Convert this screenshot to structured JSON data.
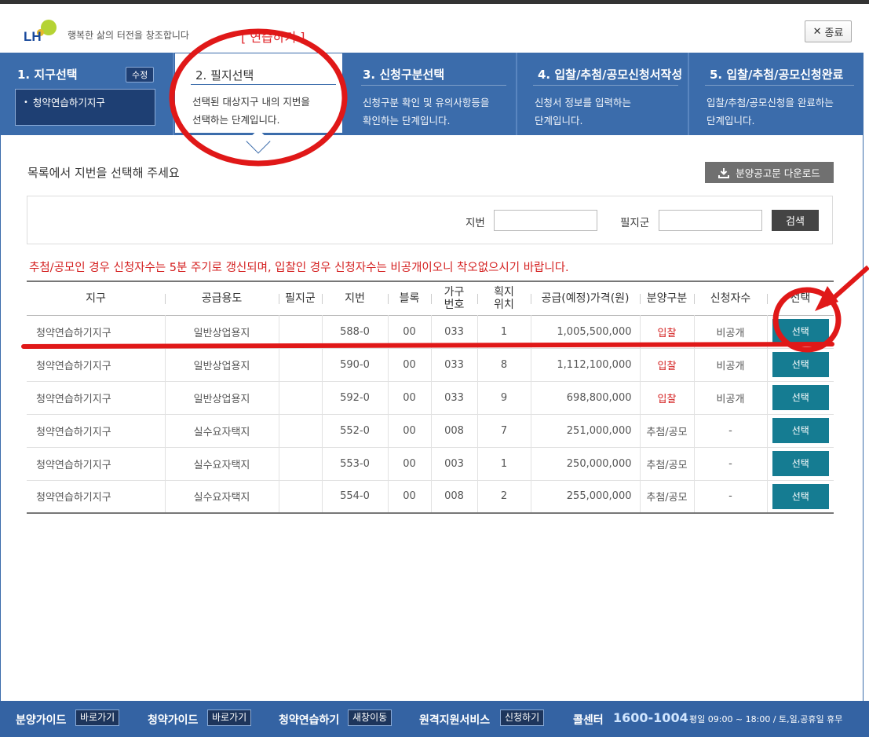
{
  "header": {
    "logo_text": "LH",
    "slogan": "행복한 삶의 터전을 창조합니다",
    "practice_label": "[ 연습하기 ]",
    "close_label": "종료"
  },
  "steps": [
    {
      "title": "1. 지구선택",
      "edit_label": "수정",
      "selected_district": "청약연습하기지구"
    },
    {
      "title": "2. 필지선택",
      "desc_line1": "선택된 대상지구 내의 지번을",
      "desc_line2": "선택하는 단계입니다."
    },
    {
      "title": "3. 신청구분선택",
      "desc_line1": "신청구분 확인 및 유의사항등을",
      "desc_line2": "확인하는 단계입니다."
    },
    {
      "title": "4. 입찰/추첨/공모신청서작성",
      "desc_line1": "신청서 정보를 입력하는",
      "desc_line2": "단계입니다."
    },
    {
      "title": "5. 입찰/추첨/공모신청완료",
      "desc_line1": "입찰/추첨/공모신청을 완료하는",
      "desc_line2": "단계입니다."
    }
  ],
  "main": {
    "instruction": "목록에서 지번을 선택해 주세요",
    "download_label": "분양공고문 다운로드",
    "search": {
      "lot_label": "지번",
      "lot_value": "",
      "group_label": "필지군",
      "group_value": "",
      "button_label": "검색"
    },
    "notice": "추첨/공모인 경우 신청자수는 5분 주기로 갱신되며, 입찰인 경우 신청자수는 비공개이오니 착오없으시기 바랍니다."
  },
  "table": {
    "headers": [
      "지구",
      "공급용도",
      "필지군",
      "지번",
      "블록",
      "가구번호",
      "획지위치",
      "공급(예정)가격(원)",
      "분양구분",
      "신청자수",
      "선택"
    ],
    "header_wrapped": {
      "h5a": "가구",
      "h5b": "번호",
      "h6a": "획지",
      "h6b": "위치"
    },
    "rows": [
      {
        "district": "청약연습하기지구",
        "use": "일반상업용지",
        "group": "",
        "lot": "588-0",
        "block": "00",
        "unit": "033",
        "position": "1",
        "price": "1,005,500,000",
        "type": "입찰",
        "applicants": "비공개",
        "select": "선택"
      },
      {
        "district": "청약연습하기지구",
        "use": "일반상업용지",
        "group": "",
        "lot": "590-0",
        "block": "00",
        "unit": "033",
        "position": "8",
        "price": "1,112,100,000",
        "type": "입찰",
        "applicants": "비공개",
        "select": "선택"
      },
      {
        "district": "청약연습하기지구",
        "use": "일반상업용지",
        "group": "",
        "lot": "592-0",
        "block": "00",
        "unit": "033",
        "position": "9",
        "price": "698,800,000",
        "type": "입찰",
        "applicants": "비공개",
        "select": "선택"
      },
      {
        "district": "청약연습하기지구",
        "use": "실수요자택지",
        "group": "",
        "lot": "552-0",
        "block": "00",
        "unit": "008",
        "position": "7",
        "price": "251,000,000",
        "type": "추첨/공모",
        "applicants": "-",
        "select": "선택"
      },
      {
        "district": "청약연습하기지구",
        "use": "실수요자택지",
        "group": "",
        "lot": "553-0",
        "block": "00",
        "unit": "003",
        "position": "1",
        "price": "250,000,000",
        "type": "추첨/공모",
        "applicants": "-",
        "select": "선택"
      },
      {
        "district": "청약연습하기지구",
        "use": "실수요자택지",
        "group": "",
        "lot": "554-0",
        "block": "00",
        "unit": "008",
        "position": "2",
        "price": "255,000,000",
        "type": "추첨/공모",
        "applicants": "-",
        "select": "선택"
      }
    ]
  },
  "footer": {
    "guide1_label": "분양가이드",
    "guide1_btn": "바로가기",
    "guide2_label": "청약가이드",
    "guide2_btn": "바로가기",
    "practice_label": "청약연습하기",
    "practice_btn": "새창이동",
    "remote_label": "원격지원서비스",
    "remote_btn": "신청하기",
    "callcenter_label": "콜센터",
    "phone": "1600-1004",
    "hours": "평일 09:00 ~ 18:00 / 토,일,공휴일 휴무"
  },
  "colors": {
    "brand_blue": "#3b6cab",
    "select_button": "#157c92",
    "notice_red": "#d42020",
    "annotation_red": "#e01818"
  }
}
